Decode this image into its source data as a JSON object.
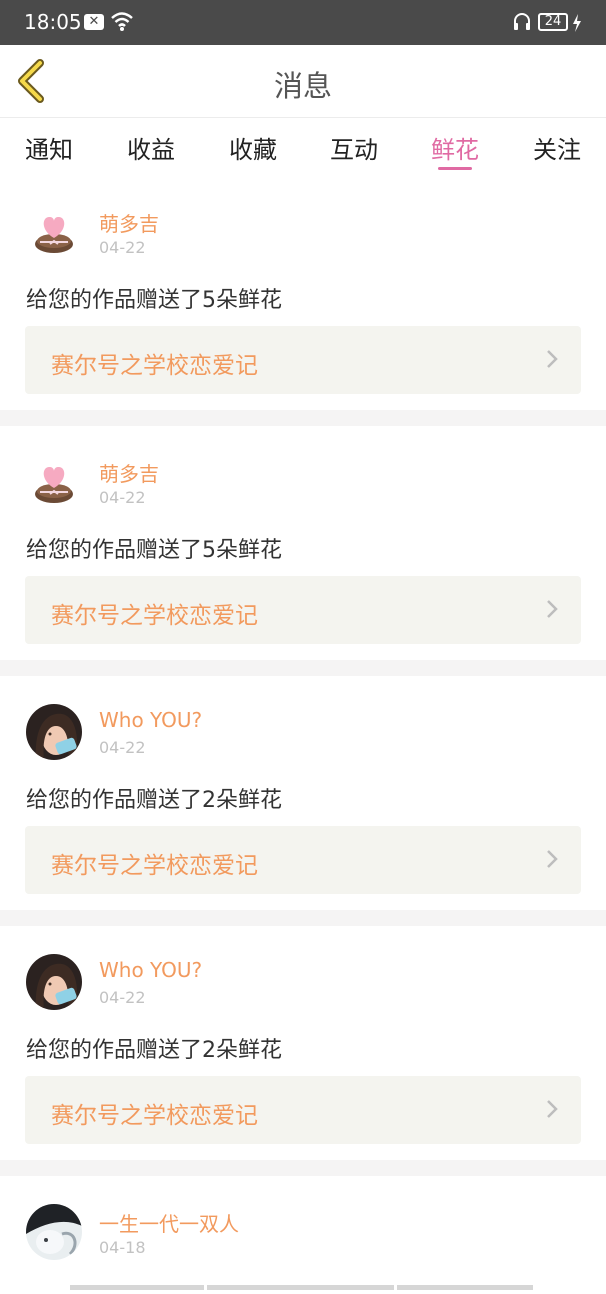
{
  "status_bar": {
    "time": "18:05",
    "battery": "24"
  },
  "header": {
    "title": "消息",
    "back_icon": "chevron-left-icon"
  },
  "tabs": [
    {
      "label": "通知",
      "active": false
    },
    {
      "label": "收益",
      "active": false
    },
    {
      "label": "收藏",
      "active": false
    },
    {
      "label": "互动",
      "active": false
    },
    {
      "label": "鲜花",
      "active": true
    },
    {
      "label": "关注",
      "active": false
    }
  ],
  "messages": [
    {
      "user": "萌多吉",
      "date": "04-22",
      "text": "给您的作品赠送了5朵鲜花",
      "work": "赛尔号之学校恋爱记",
      "avatar": "heart-cake-avatar"
    },
    {
      "user": "萌多吉",
      "date": "04-22",
      "text": "给您的作品赠送了5朵鲜花",
      "work": "赛尔号之学校恋爱记",
      "avatar": "heart-cake-avatar"
    },
    {
      "user": "Who YOU?",
      "date": "04-22",
      "text": "给您的作品赠送了2朵鲜花",
      "work": "赛尔号之学校恋爱记",
      "avatar": "girl-photo-avatar"
    },
    {
      "user": "Who YOU?",
      "date": "04-22",
      "text": "给您的作品赠送了2朵鲜花",
      "work": "赛尔号之学校恋爱记",
      "avatar": "girl-photo-avatar"
    },
    {
      "user": "一生一代一双人",
      "date": "04-18",
      "avatar": "anime-avatar"
    }
  ],
  "colors": {
    "accent": "#e06aa3",
    "username": "#f29a5e",
    "status_bar": "#4a4a4a"
  }
}
